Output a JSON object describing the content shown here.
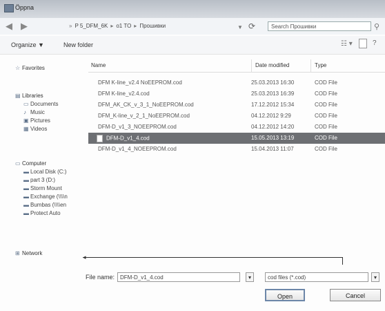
{
  "window": {
    "title": "Öppna",
    "app_icon": "folder-open-icon"
  },
  "address": {
    "back_icon": "back-arrow-icon",
    "forward_icon": "forward-arrow-icon",
    "crumbs": [
      "P 5_DFM_6K",
      "o1 TO",
      "Прошивки"
    ],
    "search_placeholder": "Search Прошивки"
  },
  "toolbar": {
    "organize_label": "Organize ▼",
    "new_folder_label": "New folder"
  },
  "nav": {
    "favorites": "Favorites",
    "libraries": "Libraries",
    "lib_items": [
      "Documents",
      "Music",
      "Pictures",
      "Videos"
    ],
    "computer": "Computer",
    "drives": [
      "Local Disk (C:)",
      "part 3 (D:)",
      "Storm Mount",
      "Exchange (\\\\\\\\n",
      "Bumbas (\\\\\\\\en",
      "Protect Auto"
    ],
    "network": "Network"
  },
  "columns": {
    "name": "Name",
    "date": "Date modified",
    "type": "Type"
  },
  "files": [
    {
      "name": "DFM K-line_v2.4 NoEEPROM.cod",
      "date": "25.03.2013 16:30",
      "type": "COD File"
    },
    {
      "name": "DFM K-line_v2.4.cod",
      "date": "25.03.2013 16:39",
      "type": "COD File"
    },
    {
      "name": "DFM_AK_CK_v_3_1_NoEEPROM.cod",
      "date": "17.12.2012 15:34",
      "type": "COD File"
    },
    {
      "name": "DFM_K-line_v_2_1_NoEEPROM.cod",
      "date": "04.12.2012 9:29",
      "type": "COD File"
    },
    {
      "name": "DFM-D_v1_3_NOEEPROM.cod",
      "date": "04.12.2012 14:20",
      "type": "COD File"
    },
    {
      "name": "DFM-D_v1_4.cod",
      "date": "15.05.2013 13:19",
      "type": "COD File"
    },
    {
      "name": "DFM-D_v1_4_NOEEPROM.cod",
      "date": "15.04.2013 11:07",
      "type": "COD File"
    }
  ],
  "footer": {
    "filename_label": "File name:",
    "filename_value": "DFM-D_v1_4.cod",
    "filetype_value": "cod files (*.cod)",
    "open_label": "Open",
    "cancel_label": "Cancel"
  }
}
